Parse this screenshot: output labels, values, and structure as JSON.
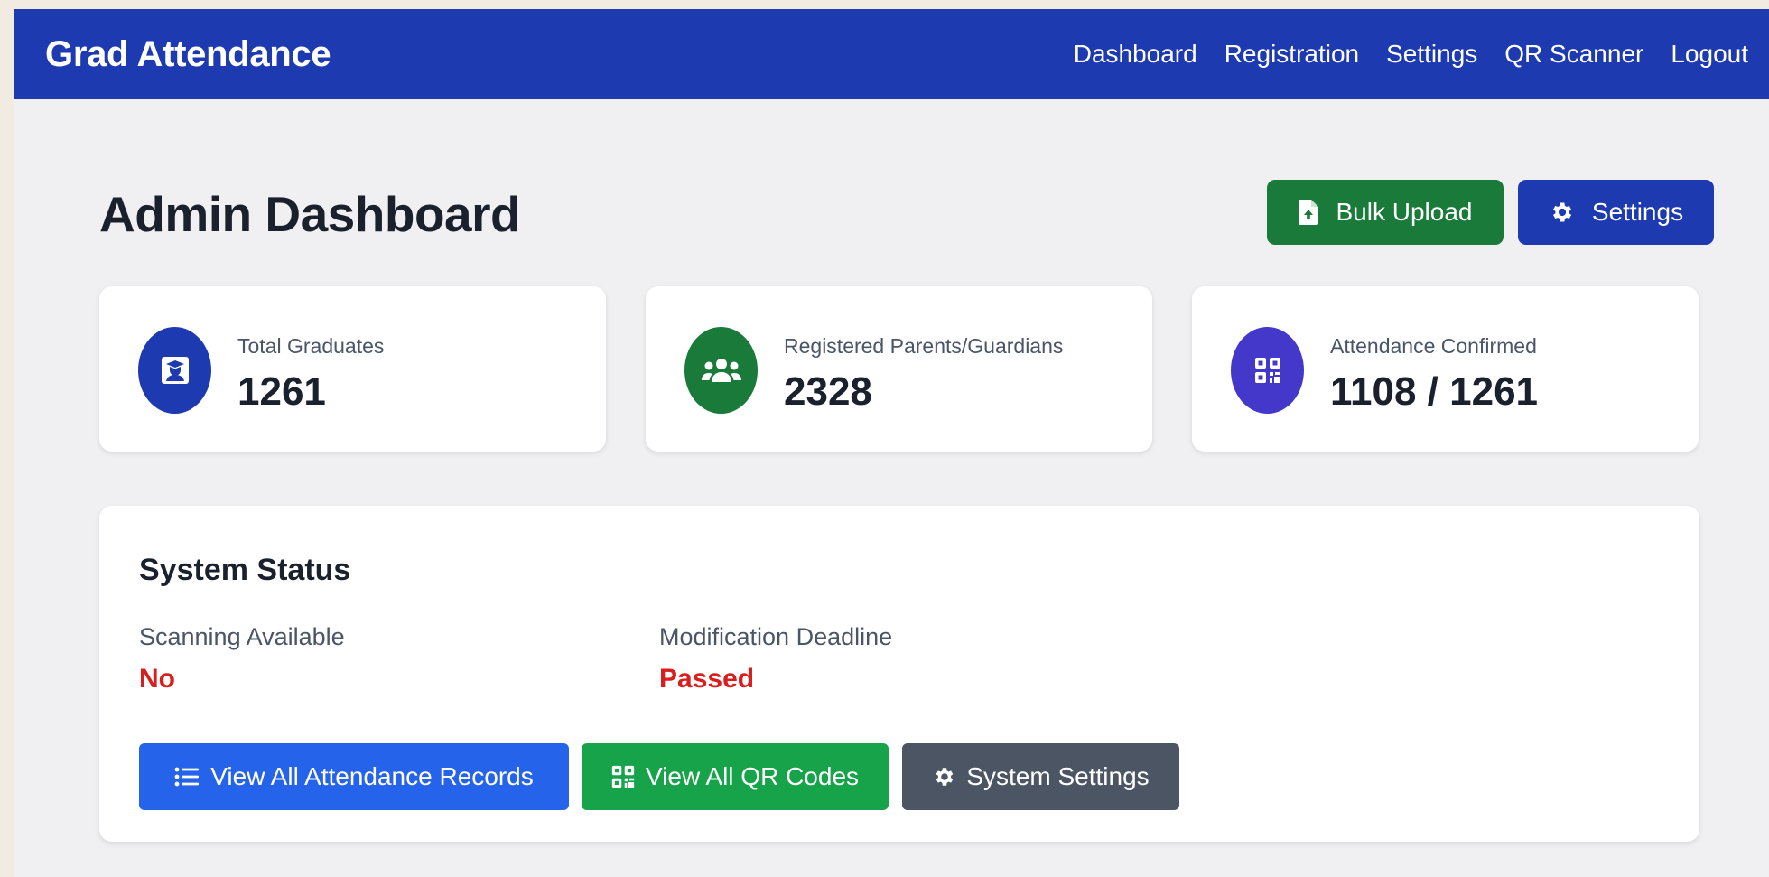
{
  "navbar": {
    "brand": "Grad Attendance",
    "links": [
      "Dashboard",
      "Registration",
      "Settings",
      "QR Scanner",
      "Logout"
    ]
  },
  "header": {
    "title": "Admin Dashboard",
    "bulk_upload_label": "Bulk Upload",
    "settings_label": "Settings"
  },
  "stats": [
    {
      "label": "Total Graduates",
      "value": "1261",
      "icon": "graduate-icon",
      "color": "#1e3ab0"
    },
    {
      "label": "Registered Parents/Guardians",
      "value": "2328",
      "icon": "users-icon",
      "color": "#197a3a"
    },
    {
      "label": "Attendance Confirmed",
      "value": "1108 / 1261",
      "icon": "qrcode-icon",
      "color": "#4338ca"
    }
  ],
  "system_status": {
    "title": "System Status",
    "scanning_label": "Scanning Available",
    "scanning_value": "No",
    "deadline_label": "Modification Deadline",
    "deadline_value": "Passed",
    "status_color": "#d91e1e"
  },
  "actions": {
    "attendance_label": "View All Attendance Records",
    "qr_label": "View All QR Codes",
    "system_settings_label": "System Settings"
  },
  "colors": {
    "nav_bg": "#1e3ab0",
    "success": "#197a3a",
    "primary": "#2563eb",
    "green": "#16a34a",
    "secondary": "#4b5563"
  }
}
